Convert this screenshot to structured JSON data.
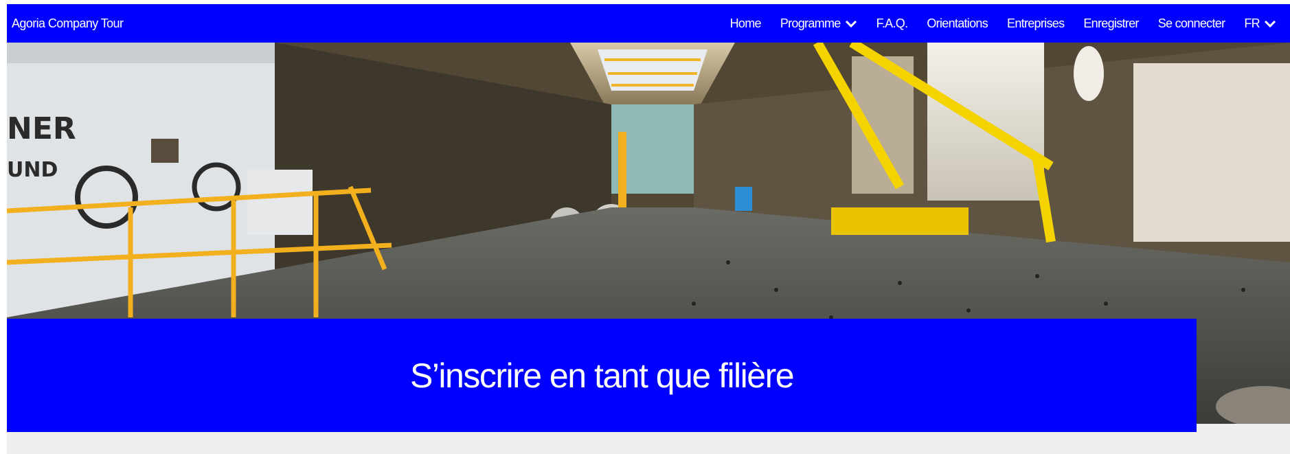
{
  "navbar": {
    "brand": "Agoria Company Tour",
    "links": [
      {
        "label": "Home",
        "dropdown": false
      },
      {
        "label": "Programme",
        "dropdown": true
      },
      {
        "label": "F.A.Q.",
        "dropdown": false
      },
      {
        "label": "Orientations",
        "dropdown": false
      },
      {
        "label": "Entreprises",
        "dropdown": false
      },
      {
        "label": "Enregistrer",
        "dropdown": false
      },
      {
        "label": "Se connecter",
        "dropdown": false
      },
      {
        "label": "FR",
        "dropdown": true
      }
    ]
  },
  "hero": {
    "image": "industrial-factory-hall-photo",
    "title": "S’inscrire en tant que filière"
  },
  "colors": {
    "brand_blue": "#0000ff",
    "page_background": "#efefef",
    "text_on_brand": "#ffffff"
  }
}
